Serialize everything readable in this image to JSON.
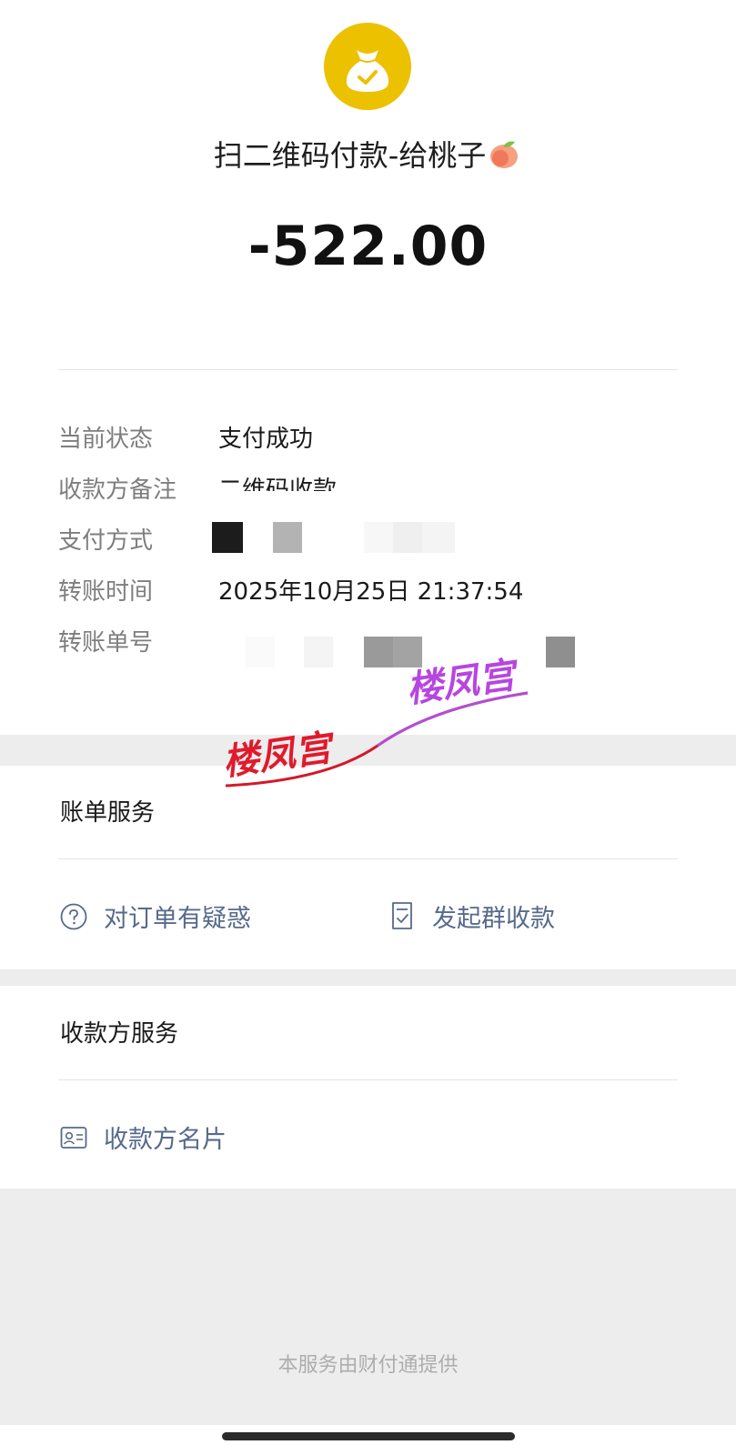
{
  "header": {
    "title": "扫二维码付款-给桃子",
    "title_emoji": "peach-icon",
    "amount": "-522.00"
  },
  "details": {
    "status_label": "当前状态",
    "status_value": "支付成功",
    "remark_label": "收款方备注",
    "remark_value": "二维码收款",
    "method_label": "支付方式",
    "time_label": "转账时间",
    "time_value": "2025年10月25日 21:37:54",
    "order_label": "转账单号"
  },
  "bill_service": {
    "title": "账单服务",
    "question_label": "对订单有疑惑",
    "group_collect_label": "发起群收款"
  },
  "payee_service": {
    "title": "收款方服务",
    "card_label": "收款方名片"
  },
  "footer": {
    "provider_text": "本服务由财付通提供"
  },
  "watermark": {
    "text": "楼凤宫"
  },
  "colors": {
    "logo_bg": "#ecc100",
    "link": "#566a8c",
    "label": "#7e7e7e",
    "gap": "#ededed"
  }
}
